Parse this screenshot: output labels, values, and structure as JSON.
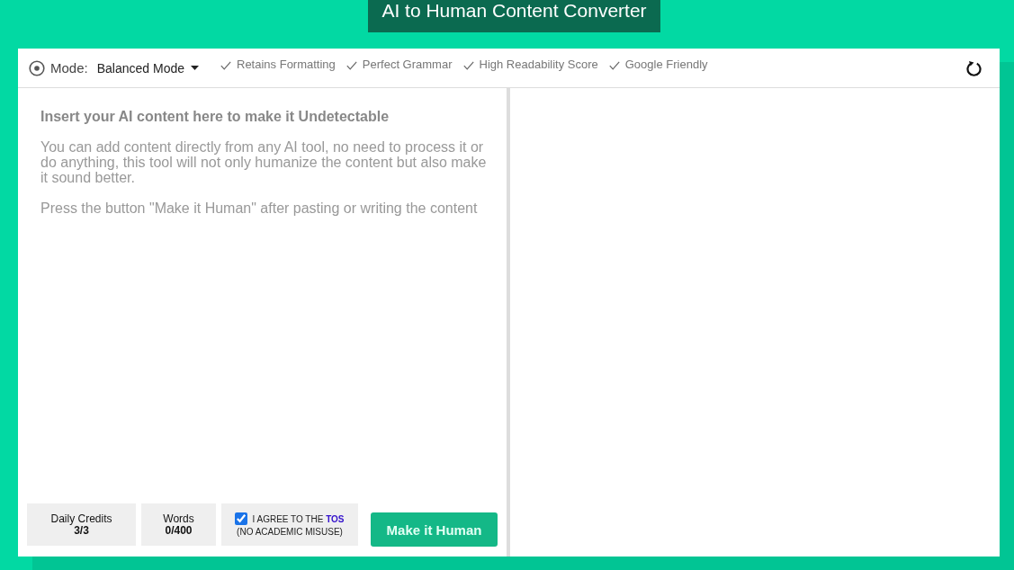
{
  "header": {
    "title": "AI to Human Content Converter"
  },
  "toolbar": {
    "mode_label": "Mode:",
    "mode_value": "Balanced Mode",
    "features": [
      "Retains Formatting",
      "Perfect Grammar",
      "High Readability Score",
      "Google Friendly"
    ]
  },
  "input": {
    "placeholder": [
      {
        "kind": "heading",
        "text": "Insert your AI content here to make it Undetectable"
      },
      {
        "kind": "paragraph",
        "text": "You can add content directly from any AI tool, no need to process it or do anything, this tool will not only humanize the content but also make it sound better."
      },
      {
        "kind": "paragraph",
        "text": "Press the button \"Make it Human\" after pasting or writing the content"
      }
    ]
  },
  "footer": {
    "stats": [
      {
        "label": "Daily Credits",
        "value": "3/3"
      },
      {
        "label": "Words",
        "value": "0/400"
      }
    ],
    "agreement": {
      "checked": true,
      "text": "I AGREE TO THE",
      "link": "TOS",
      "note": "(NO ACADEMIC MISUSE)"
    },
    "submit_button": "Make it Human"
  }
}
